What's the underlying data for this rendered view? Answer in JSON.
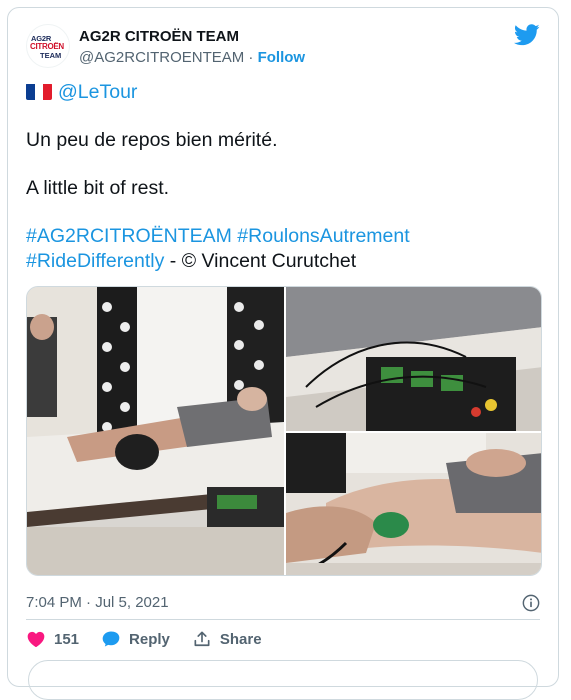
{
  "tweet": {
    "author_name": "AG2R CITROËN TEAM",
    "handle": "@AG2RCITROENTEAM",
    "separator": "·",
    "follow_label": "Follow",
    "avatar_logo": {
      "line1": "AG2R",
      "line2": "CITROËN",
      "line3": "TEAM"
    },
    "mention": "@LeTour",
    "line_fr": "Un peu de repos bien mérité.",
    "line_en": "A little bit of rest.",
    "hashtag1": "#AG2RCITROËNTEAM",
    "hashtag2": "#RoulonsAutrement",
    "hashtag3": "#RideDifferently",
    "credit": " - © Vincent Curutchet",
    "timestamp": "7:04 PM · Jul 5, 2021",
    "likes": "151",
    "reply_label": "Reply",
    "share_label": "Share",
    "colors": {
      "link": "#1b95e0",
      "like": "#f91880",
      "text": "#0f1419",
      "muted": "#536471"
    },
    "icons": [
      "twitter-bird-icon",
      "french-flag-icon",
      "info-icon",
      "heart-icon",
      "reply-icon",
      "share-icon"
    ]
  }
}
